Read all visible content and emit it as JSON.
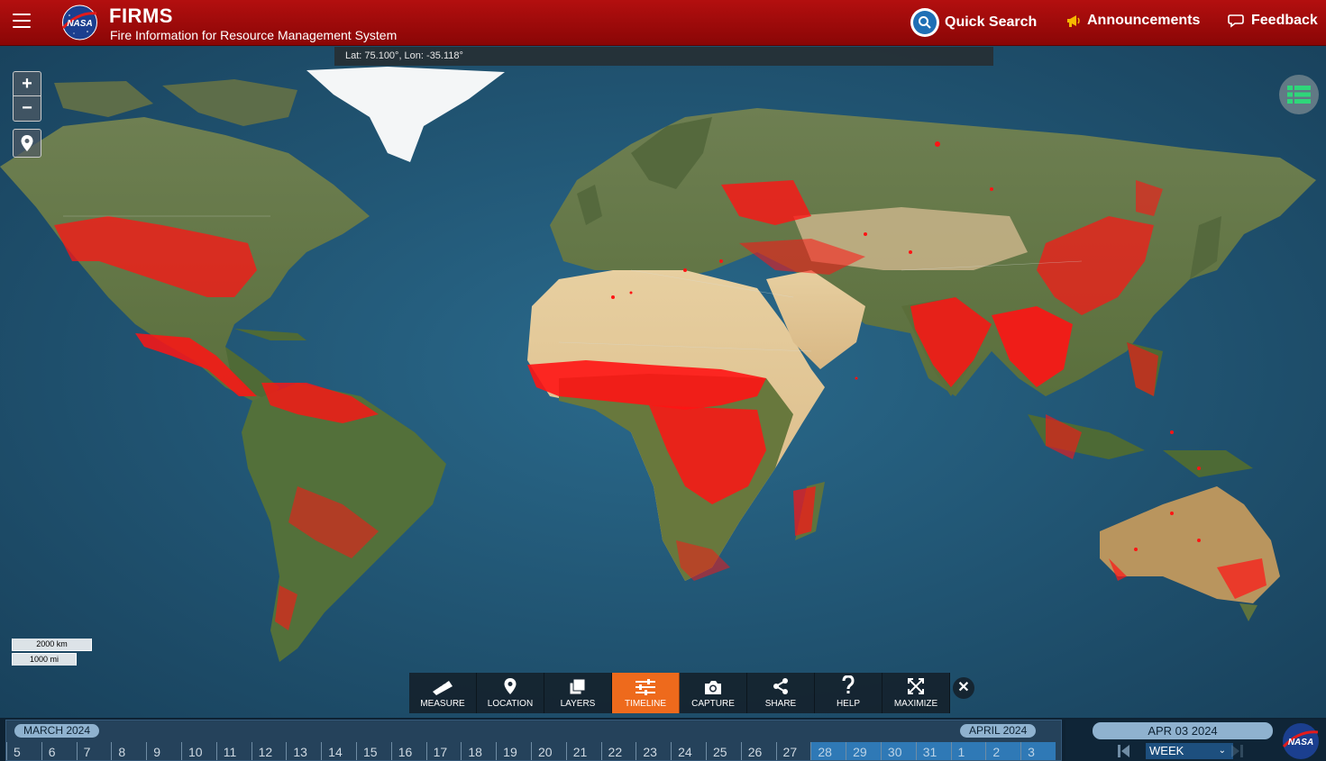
{
  "header": {
    "app_name": "FIRMS",
    "app_subtitle": "Fire Information for Resource Management System",
    "quick_search": "Quick Search",
    "announcements": "Announcements",
    "feedback": "Feedback"
  },
  "map": {
    "coordinate_readout": "Lat: 75.100°, Lon: -35.118°",
    "zoom_in": "+",
    "zoom_out": "−",
    "scale_km": "2000 km",
    "scale_mi": "1000 mi"
  },
  "toolbar": {
    "items": [
      {
        "label": "MEASURE",
        "icon": "ruler-icon"
      },
      {
        "label": "LOCATION",
        "icon": "map-pin-icon"
      },
      {
        "label": "LAYERS",
        "icon": "layers-icon"
      },
      {
        "label": "TIMELINE",
        "icon": "sliders-icon",
        "active": true
      },
      {
        "label": "CAPTURE",
        "icon": "camera-icon"
      },
      {
        "label": "SHARE",
        "icon": "share-icon"
      },
      {
        "label": "HELP",
        "icon": "question-icon"
      },
      {
        "label": "MAXIMIZE",
        "icon": "maximize-icon"
      }
    ],
    "close": "✕"
  },
  "timeline": {
    "month_1": "MARCH 2024",
    "month_2": "APRIL 2024",
    "days": [
      "5",
      "6",
      "7",
      "8",
      "9",
      "10",
      "11",
      "12",
      "13",
      "14",
      "15",
      "16",
      "17",
      "18",
      "19",
      "20",
      "21",
      "22",
      "23",
      "24",
      "25",
      "26",
      "27",
      "28",
      "29",
      "30",
      "31",
      "1",
      "2",
      "3"
    ],
    "selected_days": [
      "28",
      "29",
      "30",
      "31",
      "1",
      "2",
      "3"
    ],
    "current_date": "APR 03 2024",
    "range": "WEEK"
  },
  "colors": {
    "header_red": "#b30f0f",
    "active_orange": "#ee6a1c",
    "fire_red": "#ff1a1a",
    "ocean": "#1d4a66"
  }
}
